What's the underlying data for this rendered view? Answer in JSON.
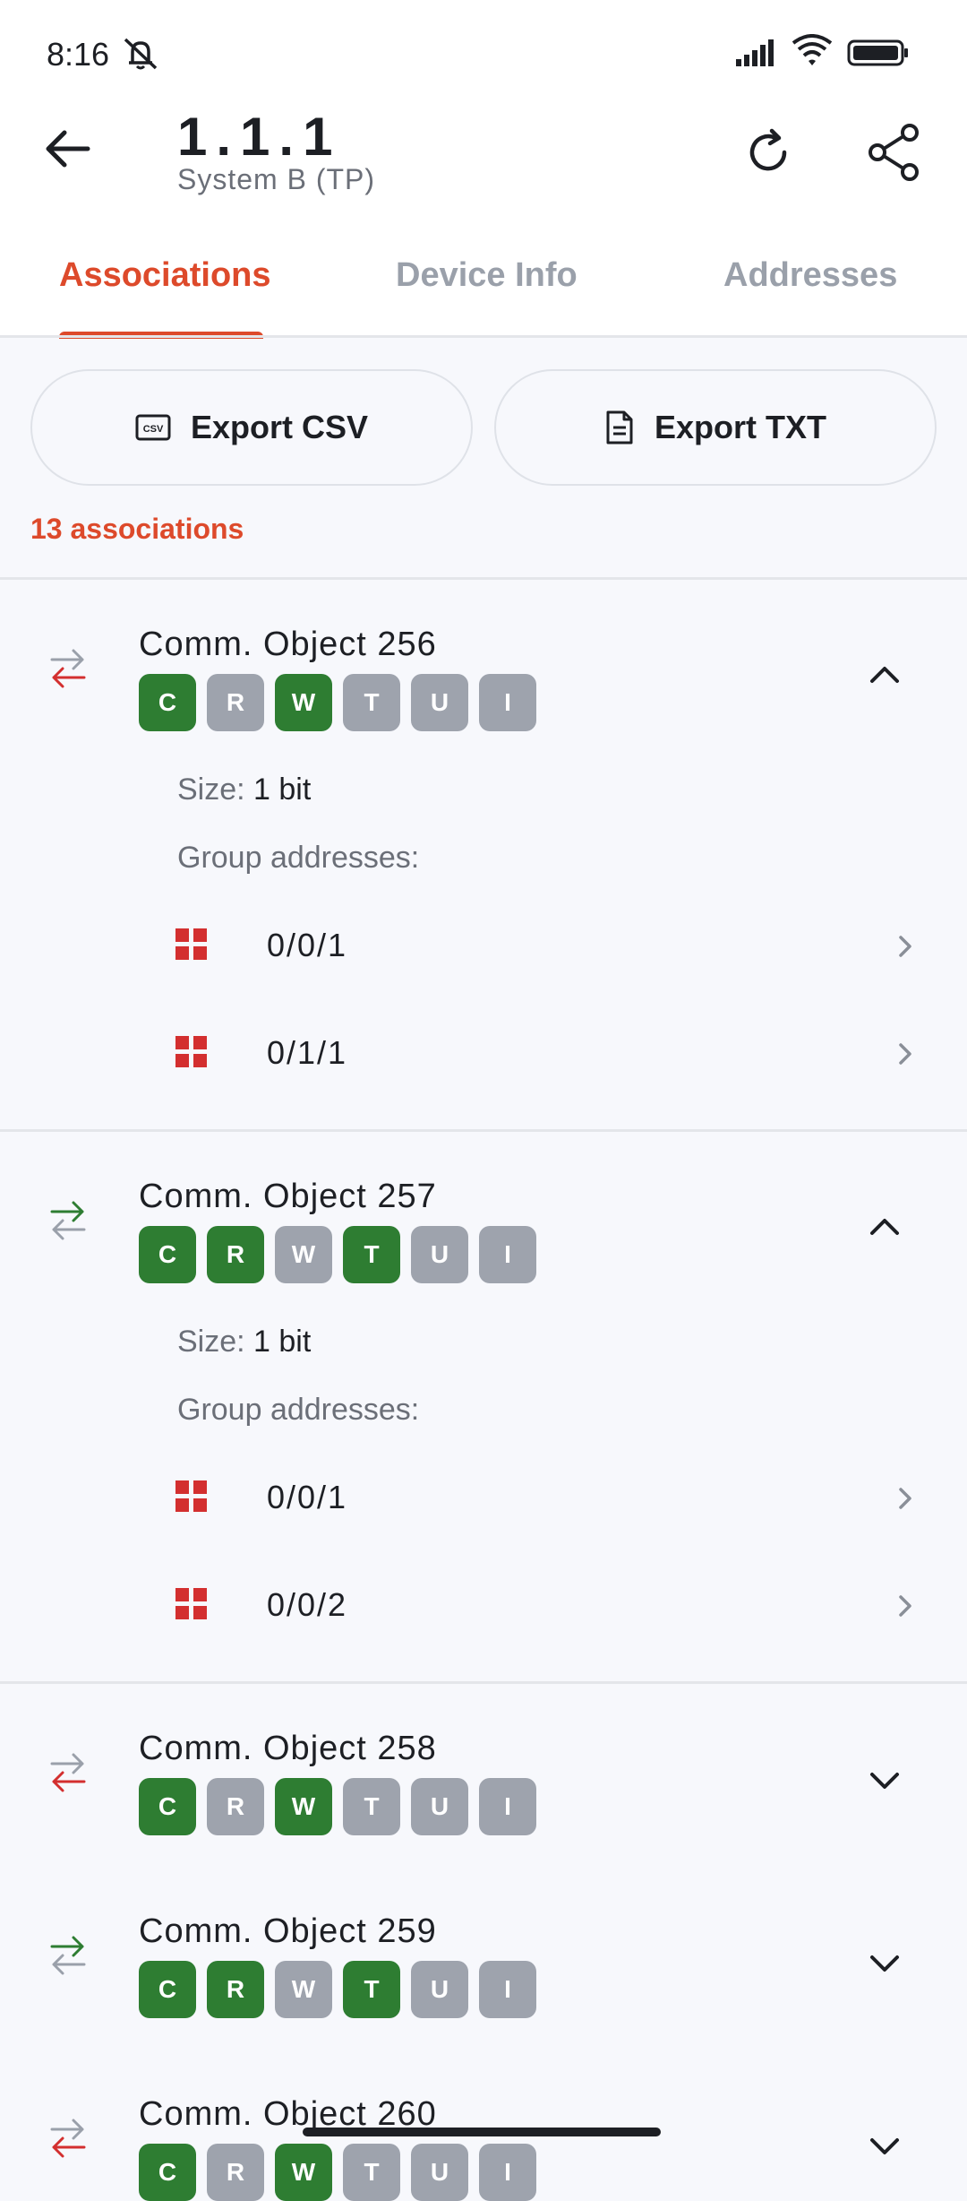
{
  "status": {
    "time": "8:16"
  },
  "header": {
    "title": "1.1.1",
    "subtitle": "System B (TP)"
  },
  "tabs": [
    {
      "label": "Associations",
      "active": true
    },
    {
      "label": "Device Info",
      "active": false
    },
    {
      "label": "Addresses",
      "active": false
    }
  ],
  "actions": {
    "export_csv": "Export CSV",
    "export_txt": "Export TXT",
    "csv_icon_text": "CSV"
  },
  "summary": {
    "count": "13 associations"
  },
  "labels": {
    "size": "Size:",
    "group_addresses": "Group addresses:"
  },
  "colors": {
    "accent": "#dd4a2b",
    "flag_on": "#2e7d32",
    "flag_off": "#9ea3ad",
    "ga_icon": "#d32f2f"
  },
  "objects": [
    {
      "name": "Comm. Object 256",
      "direction": "write",
      "expanded": true,
      "size": "1 bit",
      "flags": [
        {
          "l": "C",
          "on": true
        },
        {
          "l": "R",
          "on": false
        },
        {
          "l": "W",
          "on": true
        },
        {
          "l": "T",
          "on": false
        },
        {
          "l": "U",
          "on": false
        },
        {
          "l": "I",
          "on": false
        }
      ],
      "addresses": [
        "0/0/1",
        "0/1/1"
      ]
    },
    {
      "name": "Comm. Object 257",
      "direction": "read",
      "expanded": true,
      "size": "1 bit",
      "flags": [
        {
          "l": "C",
          "on": true
        },
        {
          "l": "R",
          "on": true
        },
        {
          "l": "W",
          "on": false
        },
        {
          "l": "T",
          "on": true
        },
        {
          "l": "U",
          "on": false
        },
        {
          "l": "I",
          "on": false
        }
      ],
      "addresses": [
        "0/0/1",
        "0/0/2"
      ]
    },
    {
      "name": "Comm. Object 258",
      "direction": "write",
      "expanded": false,
      "flags": [
        {
          "l": "C",
          "on": true
        },
        {
          "l": "R",
          "on": false
        },
        {
          "l": "W",
          "on": true
        },
        {
          "l": "T",
          "on": false
        },
        {
          "l": "U",
          "on": false
        },
        {
          "l": "I",
          "on": false
        }
      ]
    },
    {
      "name": "Comm. Object 259",
      "direction": "read",
      "expanded": false,
      "flags": [
        {
          "l": "C",
          "on": true
        },
        {
          "l": "R",
          "on": true
        },
        {
          "l": "W",
          "on": false
        },
        {
          "l": "T",
          "on": true
        },
        {
          "l": "U",
          "on": false
        },
        {
          "l": "I",
          "on": false
        }
      ]
    },
    {
      "name": "Comm. Object 260",
      "direction": "write",
      "expanded": false,
      "flags": [
        {
          "l": "C",
          "on": true
        },
        {
          "l": "R",
          "on": false
        },
        {
          "l": "W",
          "on": true
        },
        {
          "l": "T",
          "on": false
        },
        {
          "l": "U",
          "on": false
        },
        {
          "l": "I",
          "on": false
        }
      ]
    }
  ]
}
